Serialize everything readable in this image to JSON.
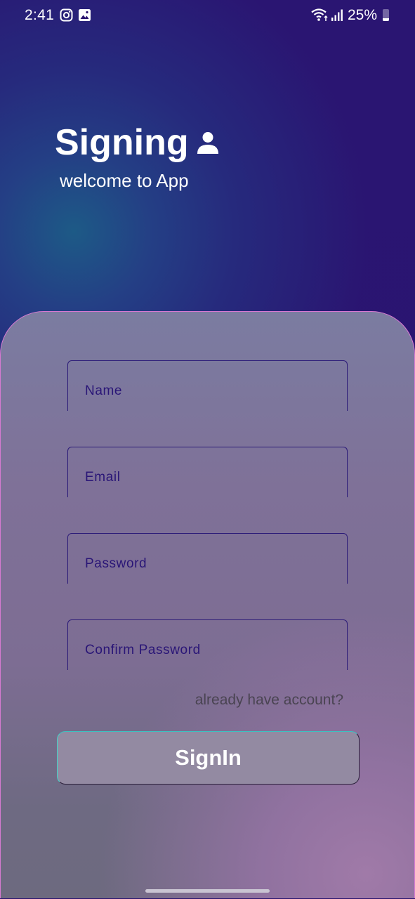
{
  "status_bar": {
    "time": "2:41",
    "battery": "25%",
    "icons": [
      "instagram-icon",
      "gallery-icon",
      "wifi-icon",
      "signal-icon",
      "battery-icon"
    ],
    "battery_level": 0.25
  },
  "header": {
    "title": "Signing",
    "subtitle": "welcome to App",
    "icon": "person-icon"
  },
  "form": {
    "fields": [
      {
        "placeholder": "Name"
      },
      {
        "placeholder": "Email"
      },
      {
        "placeholder": "Password"
      },
      {
        "placeholder": "Confirm Password"
      }
    ],
    "already_account_link": "already have account?",
    "submit_label": "SignIn"
  },
  "colors": {
    "background": "#2a1470",
    "card_border": "#d77ad2",
    "field_border": "#2c1b78",
    "placeholder_text": "#2a1677",
    "button_accent": "#43d7c9"
  }
}
